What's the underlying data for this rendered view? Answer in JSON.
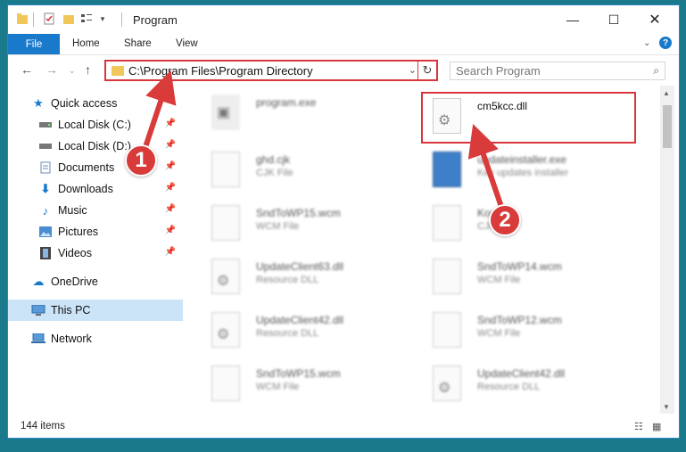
{
  "window": {
    "title": "Program"
  },
  "ribbon": {
    "tabs": [
      "File",
      "Home",
      "Share",
      "View"
    ]
  },
  "address": {
    "path": "C:\\Program Files\\Program Directory"
  },
  "search": {
    "placeholder": "Search Program"
  },
  "nav_pane": {
    "items": [
      {
        "label": "Quick access",
        "icon": "star-icon"
      },
      {
        "label": "Local Disk (C:)",
        "icon": "drive-icon",
        "pinned": true
      },
      {
        "label": "Local Disk (D:)",
        "icon": "drive-icon",
        "pinned": true
      },
      {
        "label": "Documents",
        "icon": "documents-icon",
        "pinned": true
      },
      {
        "label": "Downloads",
        "icon": "downloads-icon",
        "pinned": true
      },
      {
        "label": "Music",
        "icon": "music-icon",
        "pinned": true
      },
      {
        "label": "Pictures",
        "icon": "pictures-icon",
        "pinned": true
      },
      {
        "label": "Videos",
        "icon": "videos-icon",
        "pinned": true
      },
      {
        "label": "OneDrive",
        "icon": "onedrive-icon"
      },
      {
        "label": "This PC",
        "icon": "pc-icon",
        "selected": true
      },
      {
        "label": "Network",
        "icon": "network-icon"
      }
    ]
  },
  "files": [
    {
      "name": "program.exe",
      "type": ""
    },
    {
      "name": "cm5kcc.dll",
      "type": ""
    },
    {
      "name": "ghd.cjk",
      "type": "CJK File"
    },
    {
      "name": "updateinstaller.exe",
      "type": "Key updates installer"
    },
    {
      "name": "SndToWP15.wcm",
      "type": "WCM File"
    },
    {
      "name": "Koreani",
      "type": "CJK File"
    },
    {
      "name": "UpdateClient63.dll",
      "type": "Resource DLL"
    },
    {
      "name": "SndToWP14.wcm",
      "type": "WCM File"
    },
    {
      "name": "UpdateClient42.dll",
      "type": "Resource DLL"
    },
    {
      "name": "SndToWP12.wcm",
      "type": "WCM File"
    },
    {
      "name": "SndToWP15.wcm",
      "type": "WCM File"
    },
    {
      "name": "UpdateClient42.dll",
      "type": "Resource DLL"
    }
  ],
  "status": {
    "item_count": "144 items"
  },
  "callouts": [
    "1",
    "2"
  ],
  "colors": {
    "accent": "#1979ca",
    "highlight": "#d9363b",
    "selected": "#cce4f7"
  }
}
